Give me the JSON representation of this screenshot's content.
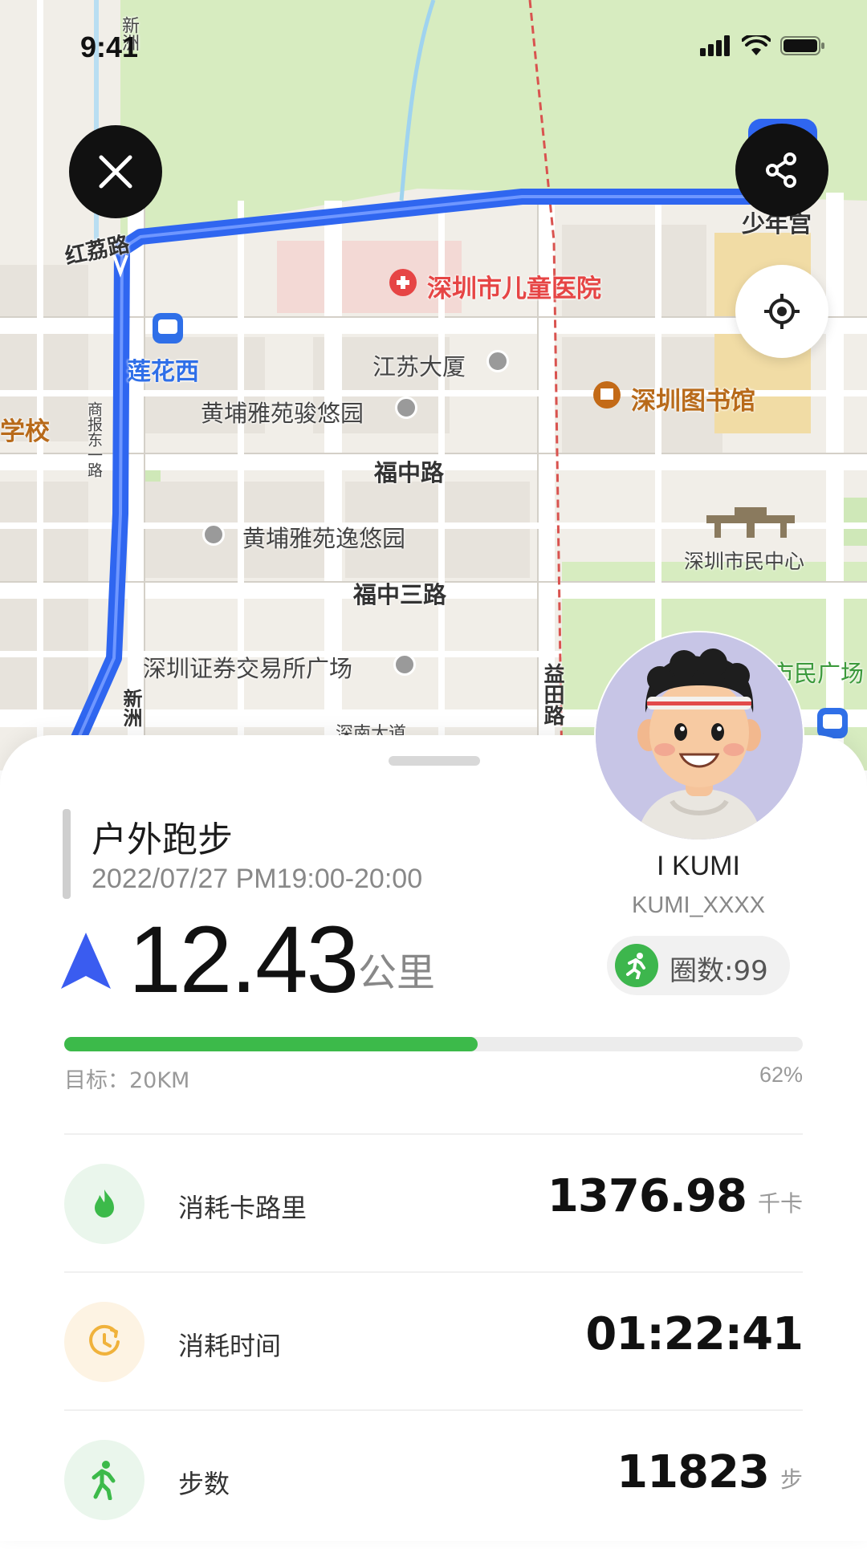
{
  "status_bar": {
    "time": "9:41"
  },
  "map": {
    "labels": {
      "hongli_road": "红荔路",
      "childrens_hospital": "深圳市儿童医院",
      "lianhua_west": "莲花西",
      "jiangsu_building": "江苏大厦",
      "shenzhen_library": "深圳图书馆",
      "huangpu_junyou": "黄埔雅苑骏悠园",
      "school_fragment": "学校",
      "fuzhong_road": "福中路",
      "huangpu_yiyou": "黄埔雅苑逸悠园",
      "civic_center": "深圳市民中心",
      "fuzhong_3rd_road": "福中三路",
      "stock_exchange_plaza": "深圳证券交易所广场",
      "civic_square": "市民广场",
      "youth_palace": "少年宫",
      "shennan_avenue": "深南大道",
      "xinzhou_road_top": "新洲",
      "xinzhou_road_bottom": "新洲",
      "yitian_road": "益田路",
      "shangbao_east": "商报东一路"
    }
  },
  "activity": {
    "title": "户外跑步",
    "time": "2022/07/27 PM19:00-20:00",
    "distance": "12.43",
    "distance_unit": "公里"
  },
  "user": {
    "name": "I KUMI",
    "id": "KUMI_XXXX",
    "laps": "圈数:99"
  },
  "goal": {
    "label": "目标：20KM",
    "percent_text": "62%",
    "progress": 0.56
  },
  "stats": [
    {
      "label": "消耗卡路里",
      "value": "1376.98",
      "unit": "千卡",
      "icon": "flame-icon",
      "color": "#3cba4a",
      "bg": "#eaf6ec"
    },
    {
      "label": "消耗时间",
      "value": "01:22:41",
      "unit": "",
      "icon": "clock-icon",
      "color": "#f0b23c",
      "bg": "#fdf3e3"
    },
    {
      "label": "步数",
      "value": "11823",
      "unit": "步",
      "icon": "walking-icon",
      "color": "#3cba4a",
      "bg": "#eaf6ec"
    }
  ],
  "colors": {
    "route": "#2f66f0",
    "progress": "#3cba4a",
    "map_park": "#d7ecc0"
  }
}
